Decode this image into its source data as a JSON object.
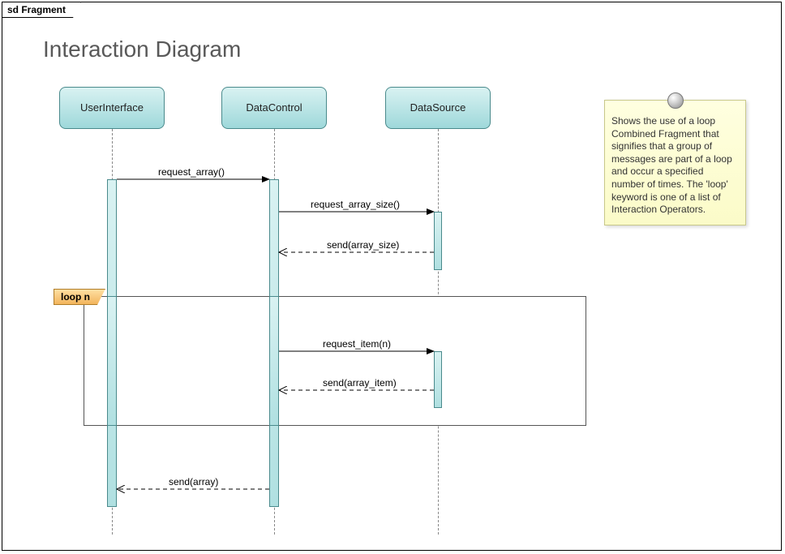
{
  "frame_label": "sd Fragment",
  "title": "Interaction Diagram",
  "lifelines": {
    "ui": "UserInterface",
    "dc": "DataControl",
    "ds": "DataSource"
  },
  "messages": {
    "m1": "request_array()",
    "m2": "request_array_size()",
    "m3": "send(array_size)",
    "m4": "request_item(n)",
    "m5": "send(array_item)",
    "m6": "send(array)"
  },
  "loop_label": "loop n",
  "note_text": "Shows the use of a loop Combined Fragment that signifies that a group of messages are part of a loop and occur a specified number of times. The 'loop' keyword is one of a list of Interaction Operators."
}
